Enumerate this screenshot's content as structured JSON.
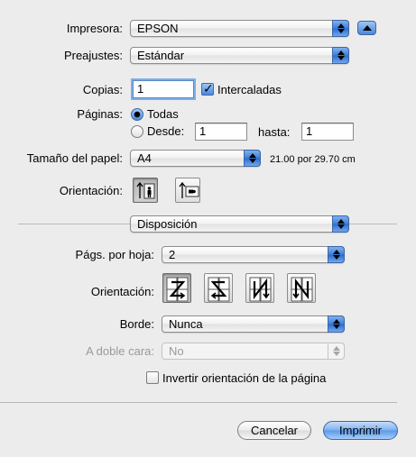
{
  "printer": {
    "label": "Impresora:",
    "value": "EPSON"
  },
  "presets": {
    "label": "Preajustes:",
    "value": "Estándar"
  },
  "copies": {
    "label": "Copias:",
    "value": "1",
    "collated_label": "Intercaladas",
    "collated": true
  },
  "pages": {
    "label": "Páginas:",
    "all_label": "Todas",
    "from_label": "Desde:",
    "from_value": "1",
    "to_label": "hasta:",
    "to_value": "1",
    "selected": "all"
  },
  "paper": {
    "label": "Tamaño del papel:",
    "value": "A4",
    "dimensions": "21.00 por 29.70 cm"
  },
  "orientation": {
    "label": "Orientación:",
    "options": [
      "portrait-icon",
      "landscape-icon"
    ],
    "selected": "portrait-icon"
  },
  "section": {
    "value": "Disposición"
  },
  "layout": {
    "pages_per_sheet_label": "Págs. por hoja:",
    "pages_per_sheet_value": "2",
    "direction_label": "Orientación:",
    "directions": [
      "layout-z-icon",
      "layout-s-icon",
      "layout-n-reverse-icon",
      "layout-n-icon"
    ],
    "selected_direction": "layout-z-icon",
    "border_label": "Borde:",
    "border_value": "Nunca",
    "duplex_label": "A doble cara:",
    "duplex_value": "No",
    "duplex_enabled": false,
    "reverse_label": "Invertir orientación de la página",
    "reverse_checked": false
  },
  "buttons": {
    "cancel": "Cancelar",
    "print": "Imprimir"
  },
  "colors": {
    "accent": "#4a88dc",
    "window": "#ececec",
    "disabled_text": "#9a9a9a"
  }
}
